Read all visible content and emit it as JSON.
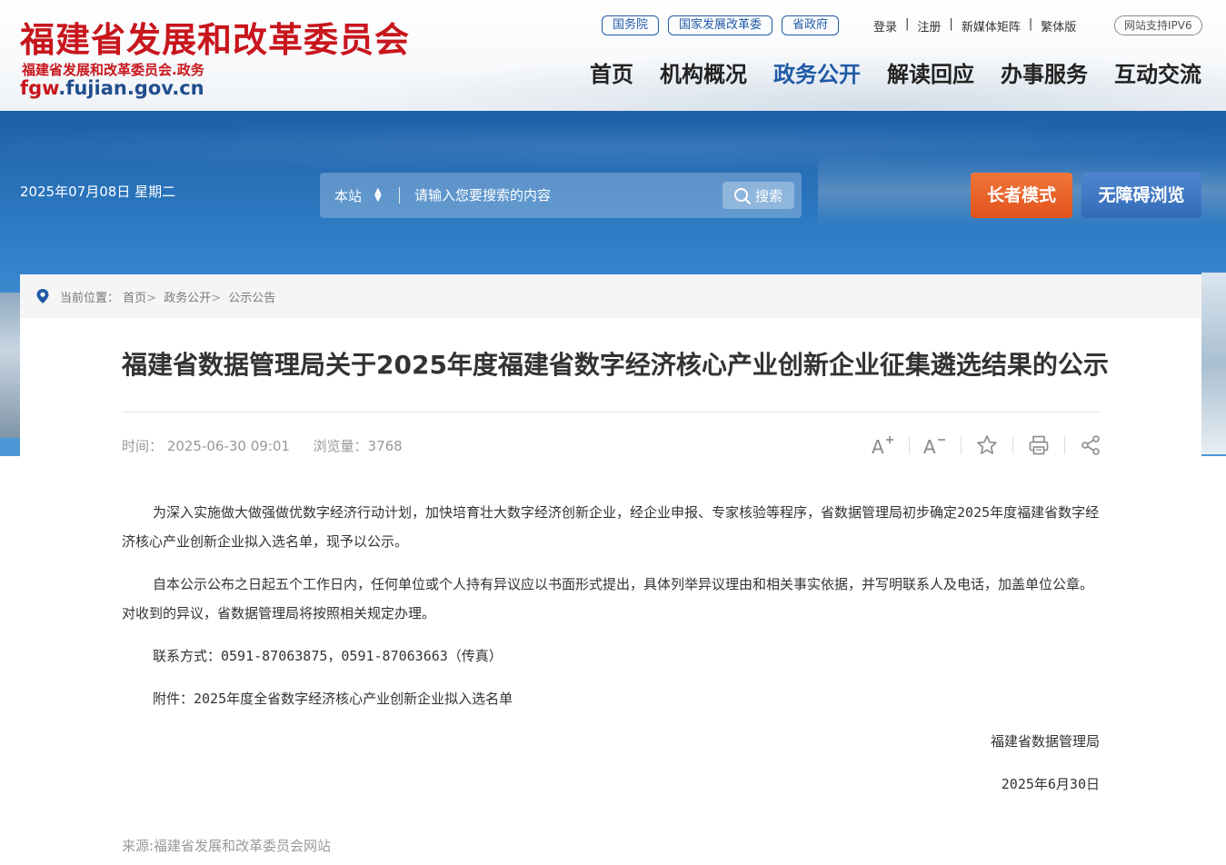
{
  "header": {
    "logo_title": "福建省发展和改革委员会",
    "logo_sub": "福建省发展和改革委员会.政务",
    "logo_domain_accent": "fgw",
    "logo_domain_rest": ".fujian.gov.cn",
    "pill_links": [
      "国务院",
      "国家发展改革委",
      "省政府"
    ],
    "top_links": [
      "登录",
      "注册",
      "新媒体矩阵",
      "繁体版"
    ],
    "ipv6": "网站支持IPV6",
    "nav": [
      "首页",
      "机构概况",
      "政务公开",
      "解读回应",
      "办事服务",
      "互动交流"
    ],
    "nav_active": "政务公开"
  },
  "banner": {
    "date": "2025年07月08日 星期二",
    "search_scope": "本站",
    "search_placeholder": "请输入您要搜索的内容",
    "search_button": "搜索",
    "elder_mode": "长者模式",
    "accessible": "无障碍浏览"
  },
  "breadcrumb": {
    "prefix": "当前位置：",
    "items": [
      "首页",
      "政务公开",
      "公示公告"
    ]
  },
  "article": {
    "title": "福建省数据管理局关于2025年度福建省数字经济核心产业创新企业征集遴选结果的公示",
    "time_label": "时间：",
    "time_value": "2025-06-30 09:01",
    "views_label": "浏览量：",
    "views_value": "3768",
    "paragraphs": [
      "为深入实施做大做强做优数字经济行动计划，加快培育壮大数字经济创新企业，经企业申报、专家核验等程序，省数据管理局初步确定2025年度福建省数字经济核心产业创新企业拟入选名单，现予以公示。",
      "自本公示公布之日起五个工作日内，任何单位或个人持有异议应以书面形式提出，具体列举异议理由和相关事实依据，并写明联系人及电话，加盖单位公章。对收到的异议，省数据管理局将按照相关规定办理。",
      "联系方式：0591-87063875，0591-87063663（传真）",
      "附件：2025年度全省数字经济核心产业创新企业拟入选名单"
    ],
    "signature_org": "福建省数据管理局",
    "signature_date": "2025年6月30日",
    "source": "来源:福建省发展和改革委员会网站"
  },
  "tools": [
    "font-increase-icon",
    "font-decrease-icon",
    "favorite-star-icon",
    "print-icon",
    "share-icon"
  ],
  "colors": {
    "brand_red": "#c8161d",
    "brand_blue": "#1f5aa6",
    "elder_orange": "#e8621f"
  }
}
